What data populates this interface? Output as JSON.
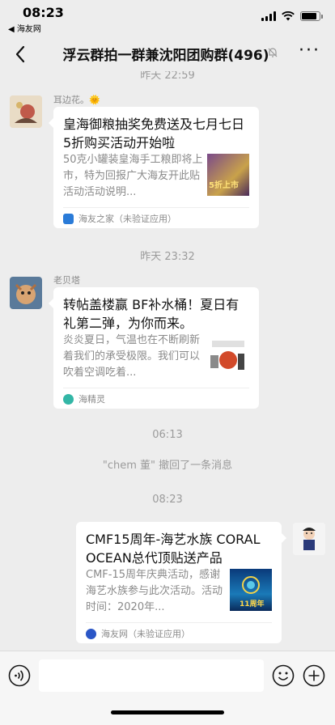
{
  "status_bar": {
    "time": "08:23",
    "back_app": "◀ 海友网"
  },
  "nav": {
    "title": "浮云群拍一群兼沈阳团购群(496)",
    "more": "···"
  },
  "chat": {
    "timestamps": [
      "昨天 22:59",
      "昨天 23:32",
      "06:13",
      "08:23"
    ],
    "recall_notice": "\"chem 董\" 撤回了一条消息",
    "messages": [
      {
        "sender": "耳边花。🌞",
        "card_title": "皇海御粮抽奖免费送及七月七日5折购买活动开始啦",
        "card_desc": "50克小罐装皇海手工粮即将上市，特为回报广大海友开此贴活动活动说明...",
        "thumb_text": "5折上市",
        "source": "海友之家（未验证应用）"
      },
      {
        "sender": "老贝塔",
        "card_title": "转帖盖楼赢 BF补水桶！夏日有礼第二弹，为你而来。",
        "card_desc": "炎炎夏日，气温也在不断刷新着我们的承受极限。我们可以吹着空调吃着...",
        "source": "海精灵"
      },
      {
        "sender": "",
        "card_title": "CMF15周年-海艺水族 CORAL OCEAN总代顶贴送产品",
        "card_desc": "CMF-15周年庆典活动，感谢海艺水族参与此次活动。活动时间：2020年...",
        "thumb_text": "11周年",
        "source": "海友网（未验证应用）"
      }
    ]
  },
  "input_bar": {
    "placeholder": ""
  },
  "colors": {
    "background": "#ededed",
    "card": "#ffffff",
    "timestamp": "#9b9b9b",
    "source_icon_1": "#2a7bd8",
    "source_icon_2": "#33b6a6",
    "source_icon_3": "#2a56c6"
  }
}
